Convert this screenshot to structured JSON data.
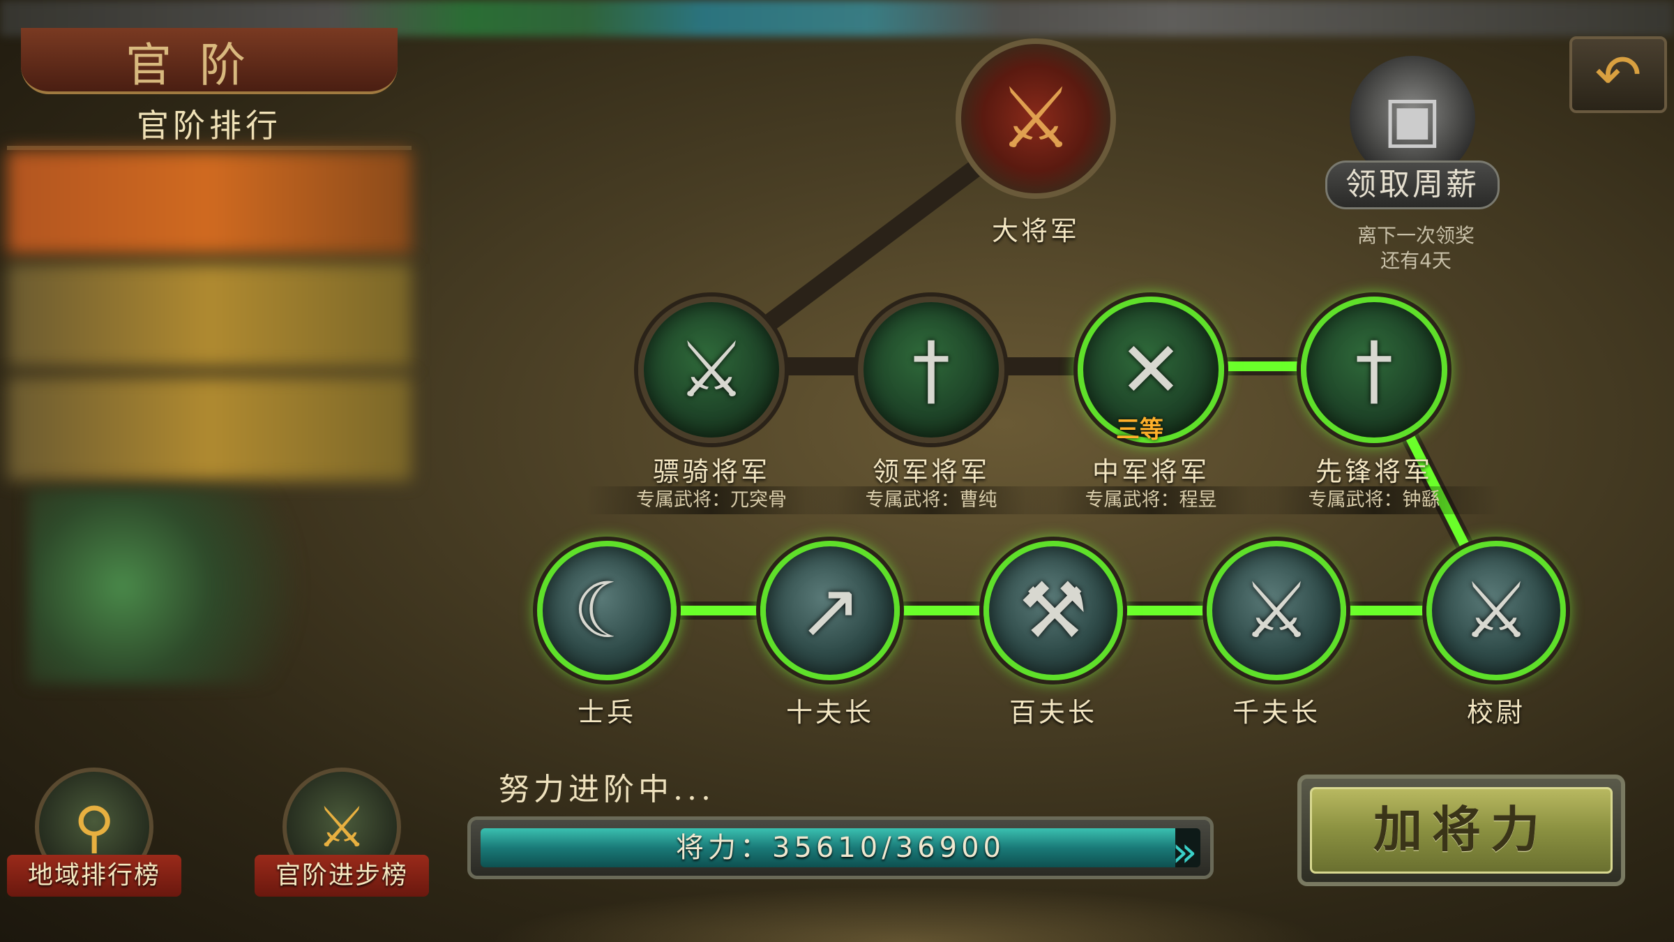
{
  "header": {
    "panel_title": "官阶",
    "rank_list_title": "官阶排行",
    "back_icon": "back-arrow-icon"
  },
  "weekly_reward": {
    "label": "领取周薪",
    "timer_line1": "离下一次领奖",
    "timer_line2": "还有4天"
  },
  "ranks": {
    "top": {
      "name": "大将军"
    },
    "upper": [
      {
        "name": "骠骑将军",
        "subtitle": "专属武将：兀突骨",
        "active": false,
        "grade": ""
      },
      {
        "name": "领军将军",
        "subtitle": "专属武将：曹纯",
        "active": false,
        "grade": ""
      },
      {
        "name": "中军将军",
        "subtitle": "专属武将：程昱",
        "active": true,
        "grade": "三等"
      },
      {
        "name": "先锋将军",
        "subtitle": "专属武将：钟繇",
        "active": true,
        "grade": ""
      }
    ],
    "lower": [
      {
        "name": "士兵",
        "active": true
      },
      {
        "name": "十夫长",
        "active": true
      },
      {
        "name": "百夫长",
        "active": true
      },
      {
        "name": "千夫长",
        "active": true
      },
      {
        "name": "校尉",
        "active": true
      }
    ]
  },
  "bottom_buttons": {
    "region_rank": "地域排行榜",
    "rank_progress": "官阶进步榜"
  },
  "progress": {
    "caption": "努力进阶中...",
    "label": "将力：35610/36900",
    "current": 35610,
    "max": 36900
  },
  "add_button": {
    "label": "加将力"
  }
}
